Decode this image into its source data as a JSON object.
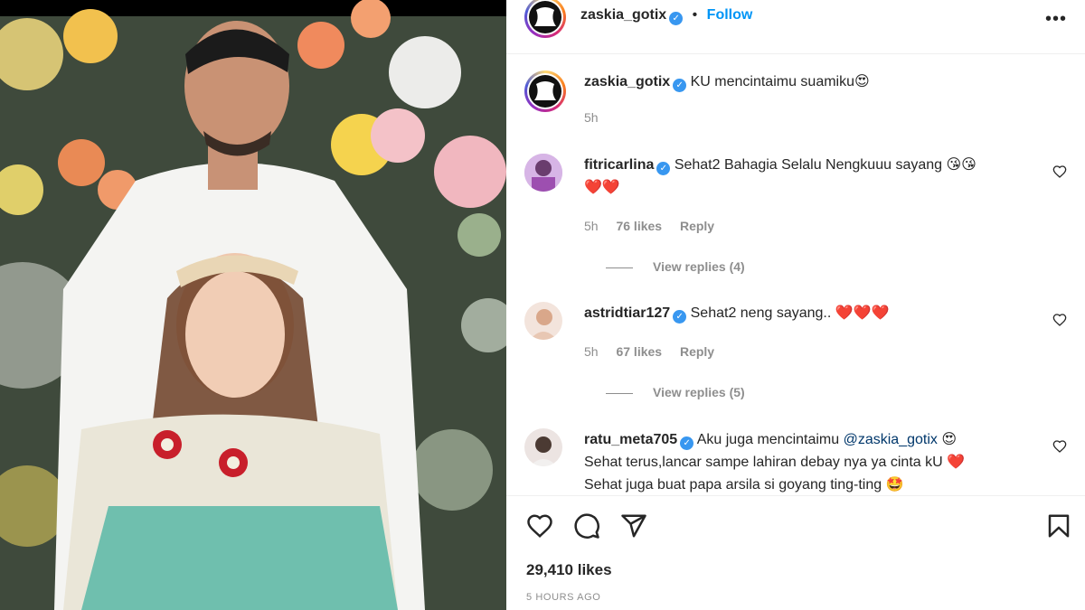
{
  "post": {
    "author": "zaskia_gotix",
    "follow_label": "Follow",
    "more_label": "•••",
    "caption": "KU mencintaimu suamiku",
    "caption_emoji": "😍",
    "caption_time": "5h"
  },
  "comments": [
    {
      "username": "fitricarlina",
      "text": "Sehat2 Bahagia Selalu Nengkuuu sayang",
      "emojis": "😘😘",
      "line2": "❤️❤️",
      "time": "5h",
      "likes": "76 likes",
      "reply": "Reply",
      "view_replies": "View replies (4)"
    },
    {
      "username": "astridtiar127",
      "text": "Sehat2 neng sayang..",
      "emojis": "❤️❤️❤️",
      "time": "5h",
      "likes": "67 likes",
      "reply": "Reply",
      "view_replies": "View replies (5)"
    },
    {
      "username": "ratu_meta705",
      "text": "Aku juga mencintaimu",
      "mention": "@zaskia_gotix",
      "emoji1": "😍",
      "line2": "Sehat terus,lancar sampe lahiran debay nya ya cinta kU",
      "line2_emoji": "❤️",
      "line3": "Sehat juga buat papa arsila si goyang ting-ting",
      "line3_emoji": "🤩"
    }
  ],
  "footer": {
    "likes_total": "29,410 likes",
    "time_ago": "5 HOURS AGO"
  },
  "icons": {
    "like": "heart-icon",
    "comment": "comment-icon",
    "share": "share-icon",
    "save": "bookmark-icon",
    "verified": "verified-badge-icon",
    "comment_like": "heart-outline-icon"
  },
  "colors": {
    "link": "#0095f6",
    "verified": "#3897f0",
    "muted": "#8e8e8e"
  }
}
